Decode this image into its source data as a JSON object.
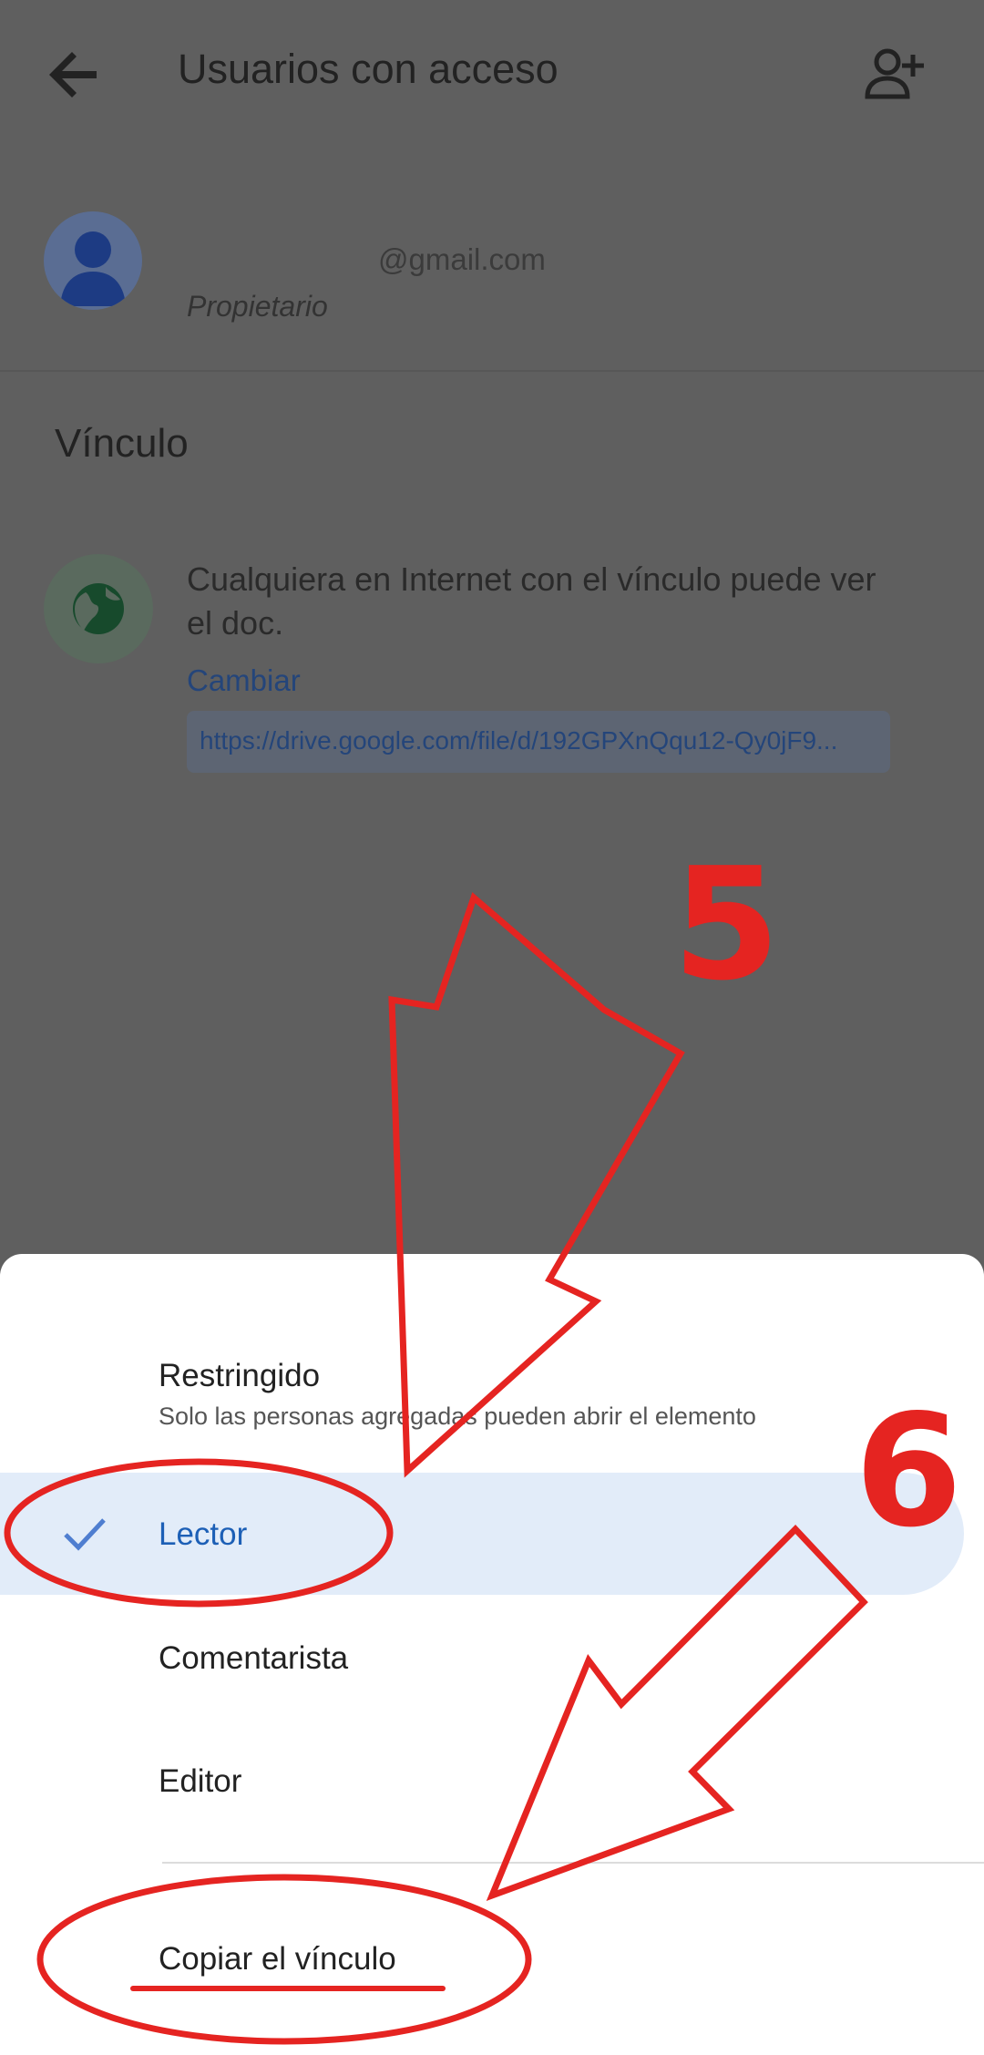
{
  "header": {
    "title": "Usuarios con acceso",
    "back_icon": "arrow-left-icon",
    "add_icon": "person-add-icon"
  },
  "owner": {
    "email": "@gmail.com",
    "role": "Propietario"
  },
  "link_section": {
    "title": "Vínculo",
    "description": "Cualquiera en Internet con el vínculo puede ver el doc.",
    "change_label": "Cambiar",
    "url": "https://drive.google.com/file/d/192GPXnQqu12-Qy0jF9..."
  },
  "sheet": {
    "options": [
      {
        "title": "Restringido",
        "subtitle": "Solo las personas agregadas pueden abrir el elemento"
      },
      {
        "title": "Lector",
        "selected": true
      },
      {
        "title": "Comentarista"
      },
      {
        "title": "Editor"
      }
    ],
    "copy_link": "Copiar el vínculo"
  },
  "annotations": {
    "step1": "5",
    "step2": "6"
  },
  "colors": {
    "accent": "#1c5fb6",
    "selected_bg": "#e2ecf9",
    "annotation_red": "#e52421"
  }
}
